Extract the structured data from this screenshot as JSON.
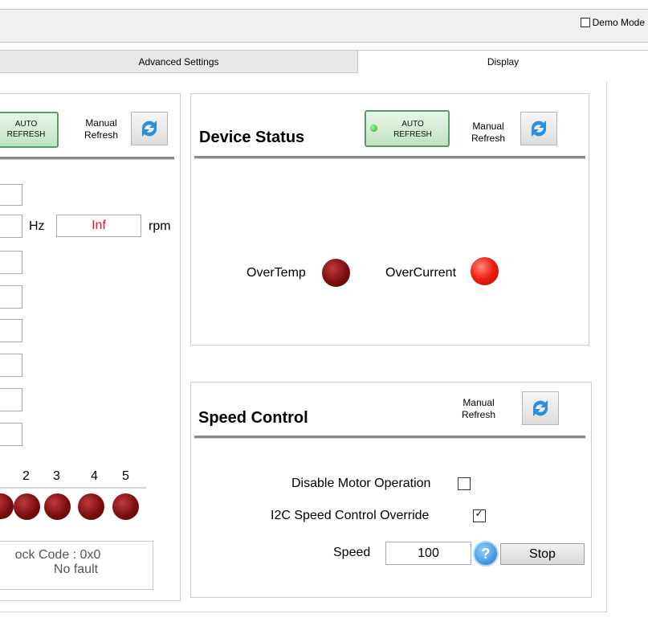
{
  "top_bar": {
    "demo_mode_label": "Demo Mode",
    "demo_mode_checked": false
  },
  "tabs": [
    {
      "label": "Advanced Settings",
      "active": false
    },
    {
      "label": "Display",
      "active": true
    }
  ],
  "left_panel": {
    "auto_refresh_label_1": "AUTO",
    "auto_refresh_label_2": "REFRESH",
    "manual_refresh_label_1": "Manual",
    "manual_refresh_label_2": "Refresh",
    "hz_unit": "Hz",
    "rpm_value": "Inf",
    "rpm_unit": "rpm",
    "led_numbers": [
      "2",
      "3",
      "4",
      "5"
    ],
    "fault_code": "ock Code : 0x0",
    "fault_text": "No fault"
  },
  "device_status": {
    "title": "Device Status",
    "auto_refresh_label_1": "AUTO",
    "auto_refresh_label_2": "REFRESH",
    "manual_refresh_label_1": "Manual",
    "manual_refresh_label_2": "Refresh",
    "overtemp_label": "OverTemp",
    "overcurrent_label": "OverCurrent"
  },
  "speed_control": {
    "title": "Speed Control",
    "manual_refresh_label_1": "Manual",
    "manual_refresh_label_2": "Refresh",
    "disable_motor_label": "Disable Motor Operation",
    "disable_motor_checked": false,
    "i2c_override_label": "I2C Speed Control Override",
    "i2c_override_checked": true,
    "speed_label": "Speed",
    "speed_value": "100",
    "stop_label": "Stop"
  },
  "colors": {
    "led_dark_red": "#7a0e10",
    "led_bright_red": "#ef1a0e",
    "rpm_text": "#e8141b",
    "led_green": "#1fae2f"
  },
  "icons": [
    "refresh-icon",
    "help-icon"
  ]
}
